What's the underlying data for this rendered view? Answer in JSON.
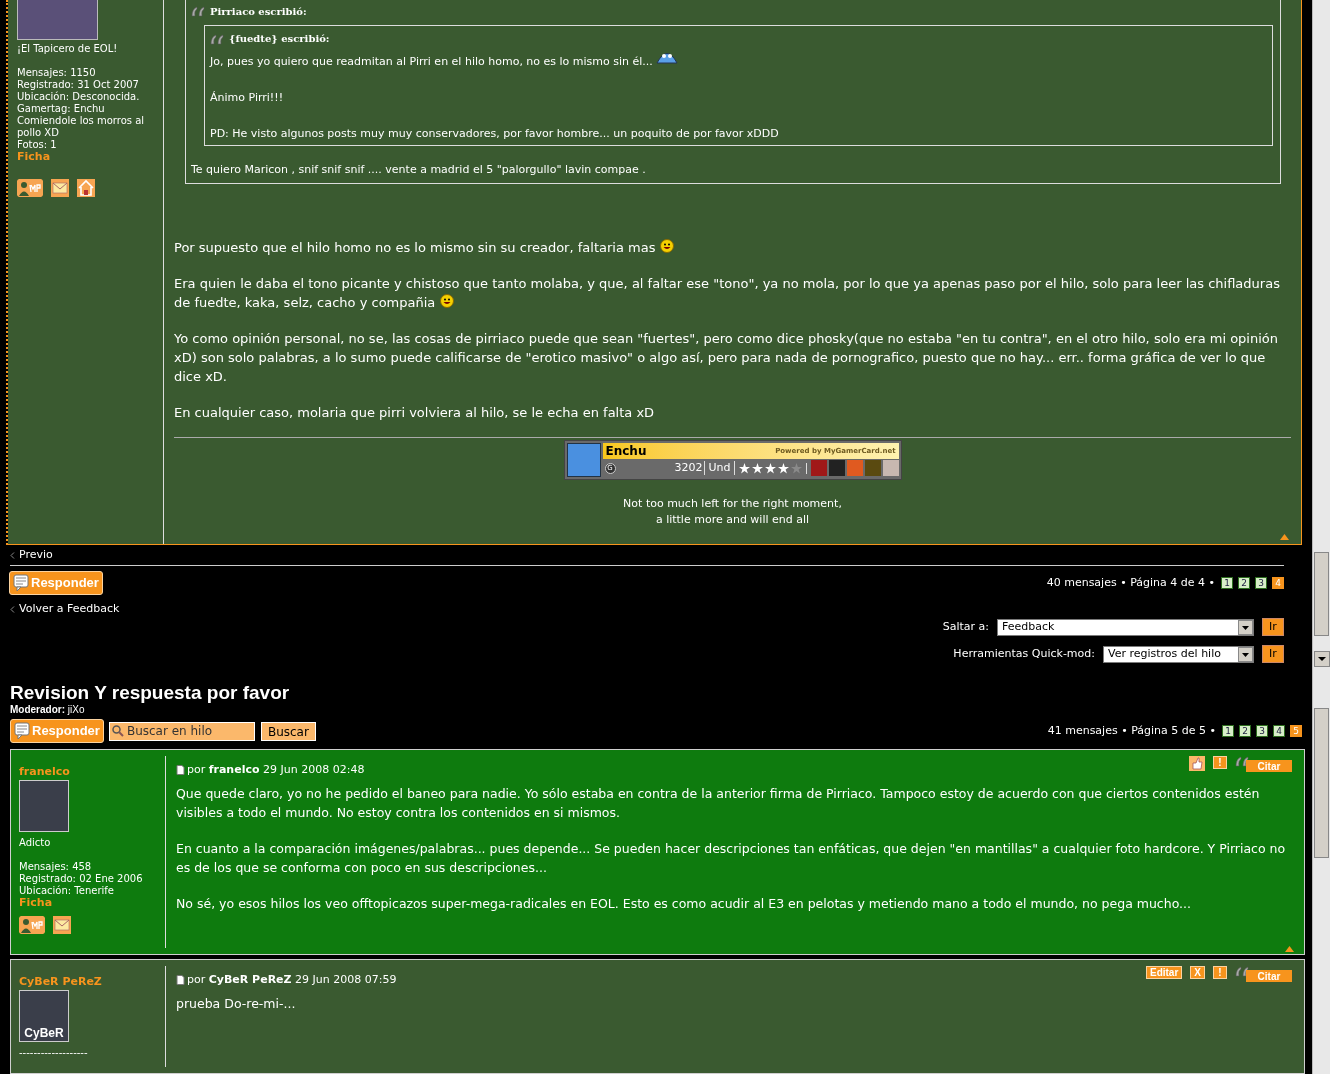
{
  "top_frame": {
    "author": {
      "rank": "¡El Tapicero de EOL!",
      "profile_lines": [
        "Mensajes: 1150",
        "Registrado: 31 Oct 2007",
        "Ubicación: Desconocida.",
        "Gamertag: Enchu",
        "Comiendole los morros al pollo XD",
        "Fotos: 1"
      ],
      "profile_link": "Ficha",
      "contact_icons": [
        {
          "kind": "pm"
        },
        {
          "kind": "email"
        },
        {
          "kind": "home"
        }
      ]
    },
    "quote": {
      "author": "Pirriaco escribió:",
      "inner": {
        "author": "{fuedte} escribió:",
        "paragraphs": [
          "Jo, pues yo quiero que readmitan al Pirri en el hilo homo, no es lo mismo sin él...",
          "Ánimo Pirri!!!",
          "PD: He visto algunos posts muy muy conservadores, por favor hombre... un poquito de por favor xDDD"
        ]
      },
      "text": "Te quiero Maricon , snif snif snif .... vente a madrid el 5 \"palorgullo\" lavin compae ."
    },
    "paragraphs": [
      {
        "text": "Por supuesto que el hilo homo no es lo mismo sin su creador, faltaria mas",
        "smiley": true
      },
      {
        "text": "Era quien le daba el tono picante y chistoso que tanto molaba, y que, al faltar ese \"tono\", ya no mola, por lo que ya apenas paso por el hilo, solo para leer las chifladuras de fuedte, kaka, selz, cacho y compañia",
        "smiley": true
      },
      {
        "text": "Yo como opinión personal, no se, las cosas de pirriaco puede que sean \"fuertes\", pero como dice phosky(que no estaba \"en tu contra\", en el otro hilo, solo era mi opinión xD) son solo palabras, a lo sumo puede calificarse de \"erotico masivo\" o algo así, pero para nada de pornografico, puesto que no hay... err.. forma gráfica de ver lo que dice xD.",
        "smiley": false
      },
      {
        "text": "En cualquier caso, molaria que pirri volviera al hilo, se le echa en falta xD",
        "smiley": false
      }
    ],
    "gamercard": {
      "gamertag": "Enchu",
      "powered_by": "Powered by MyGamerCard.net",
      "score_label": "G",
      "score": "3202",
      "zone": "Und",
      "stars": 4
    },
    "signature": [
      "Not too much left for the right moment,",
      "a little more and will end all"
    ],
    "nav": {
      "previous": "Previo",
      "reply": "Responder",
      "summary": "40 mensajes • Página 4 de 4 •",
      "pages": [
        {
          "label": "1",
          "selected": false
        },
        {
          "label": "2",
          "selected": false
        },
        {
          "label": "3",
          "selected": false
        },
        {
          "label": "4",
          "selected": true
        }
      ],
      "back": "Volver a Feedback",
      "jump_label": "Saltar a:",
      "jump_value": "Feedback",
      "jump_go": "Ir",
      "quickmod_label": "Herramientas Quick-mod:",
      "quickmod_value": "Ver registros del hilo",
      "quickmod_go": "Ir"
    }
  },
  "bottom_frame": {
    "title": "Revision Y respuesta por favor",
    "moderator": "**Moderador:** jiXo",
    "reply": "Responder",
    "search_placeholder": "Buscar en hilo",
    "search_button": "Buscar",
    "summary": "41 mensajes • Página 5 de 5 •",
    "pages": [
      {
        "label": "1",
        "selected": false
      },
      {
        "label": "2",
        "selected": false
      },
      {
        "label": "3",
        "selected": false
      },
      {
        "label": "4",
        "selected": false
      },
      {
        "label": "5",
        "selected": true
      }
    ],
    "posts": [
      {
        "author": "franelco",
        "highlighted": true,
        "rank": "Adicto",
        "profile_lines": [
          "Mensajes: 458",
          "Registrado: 02 Ene 2006",
          "Ubicación: Tenerife"
        ],
        "profile_link": "Ficha",
        "contact_icons": [
          {
            "kind": "pm"
          },
          {
            "kind": "email"
          }
        ],
        "byline": "por **franelco** 29 Jun 2008 02:48",
        "actions": [
          {
            "kind": "icon"
          },
          {
            "kind": "text",
            "label": "!"
          },
          {
            "kind": "quote",
            "label": "Citar"
          }
        ],
        "paragraphs": [
          "Que quede claro, yo no he pedido el baneo para nadie. Yo sólo estaba en contra de la anterior firma de Pirriaco. Tampoco estoy de acuerdo con que ciertos contenidos estén visibles a todo el mundo. No estoy contra los contenidos en si mismos.",
          "En cuanto a la comparación imágenes/palabras... pues depende... Se pueden hacer descripciones tan enfáticas, que dejen \"en mantillas\" a cualquier foto hardcore. Y Pirriaco no es de los que se conforma con poco en sus descripciones...",
          "No sé, yo esos hilos los veo offtopicazos super-mega-radicales en EOL. Esto es como acudir al E3 en pelotas y metiendo mano a todo el mundo, no pega mucho..."
        ]
      },
      {
        "author": "CyBeR PeReZ",
        "highlighted": false,
        "avatar_caption": "CyBeR",
        "rank": "-------------------",
        "byline": "por **CyBeR PeReZ** 29 Jun 2008 07:59",
        "actions": [
          {
            "kind": "text",
            "label": "Editar"
          },
          {
            "kind": "text",
            "label": "X"
          },
          {
            "kind": "text",
            "label": "!"
          },
          {
            "kind": "quote",
            "label": "Citar"
          }
        ],
        "paragraphs": [
          "prueba Do-re-mi-..."
        ]
      }
    ]
  }
}
